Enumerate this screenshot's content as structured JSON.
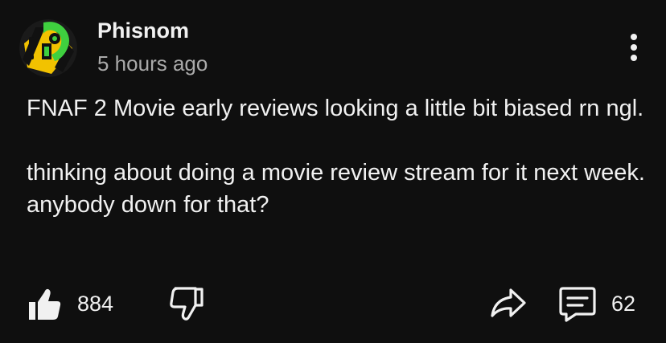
{
  "post": {
    "author": {
      "name": "Phisnom",
      "avatar_icon": "phisnom-avatar-icon"
    },
    "timestamp": "5 hours ago",
    "body": {
      "paragraph1": "FNAF 2 Movie early reviews looking a little bit biased rn ngl.",
      "paragraph2": "thinking about doing a movie review stream for it next week. anybody down for that?"
    },
    "actions": {
      "like_icon": "thumbs-up-icon",
      "like_count": "884",
      "dislike_icon": "thumbs-down-icon",
      "share_icon": "share-icon",
      "comment_icon": "comment-icon",
      "comment_count": "62",
      "more_icon": "more-vertical-icon"
    }
  },
  "colors": {
    "background": "#0f0f0f",
    "text_primary": "#f1f1f1",
    "text_secondary": "#aaaaaa",
    "avatar_yellow": "#f2c200",
    "avatar_green": "#3fd03f"
  }
}
